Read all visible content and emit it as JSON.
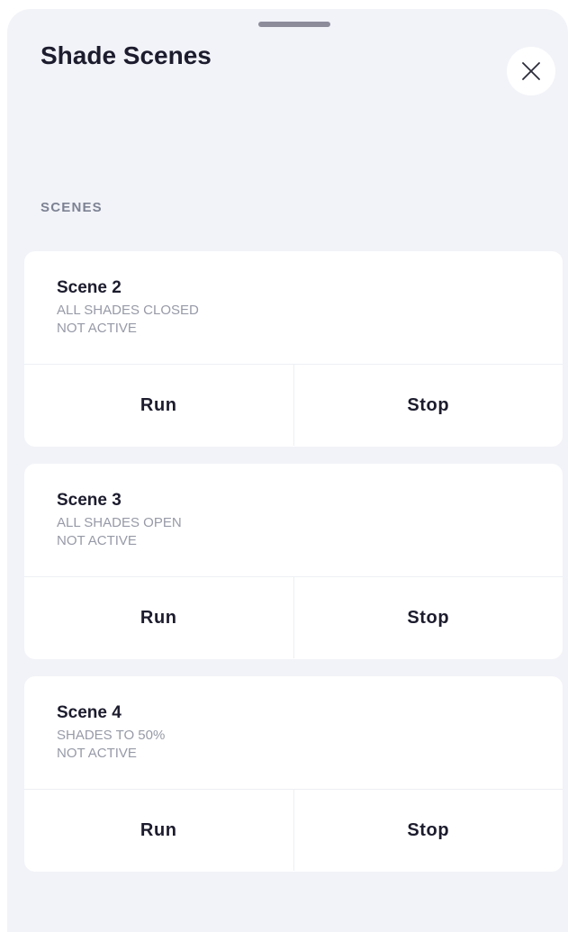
{
  "sheet": {
    "title": "Shade Scenes",
    "close_icon": "close-icon"
  },
  "section": {
    "label": "SCENES"
  },
  "scenes": [
    {
      "name": "Scene 2",
      "description": "ALL SHADES CLOSED",
      "status": "NOT ACTIVE",
      "run_label": "Run",
      "stop_label": "Stop"
    },
    {
      "name": "Scene 3",
      "description": "ALL SHADES OPEN",
      "status": "NOT ACTIVE",
      "run_label": "Run",
      "stop_label": "Stop"
    },
    {
      "name": "Scene 4",
      "description": "SHADES TO 50%",
      "status": "NOT ACTIVE",
      "run_label": "Run",
      "stop_label": "Stop"
    }
  ],
  "colors": {
    "sheet_background": "#f2f3f8",
    "card_background": "#ffffff",
    "text_primary": "#1c1c2e",
    "text_secondary": "#979aa7"
  }
}
